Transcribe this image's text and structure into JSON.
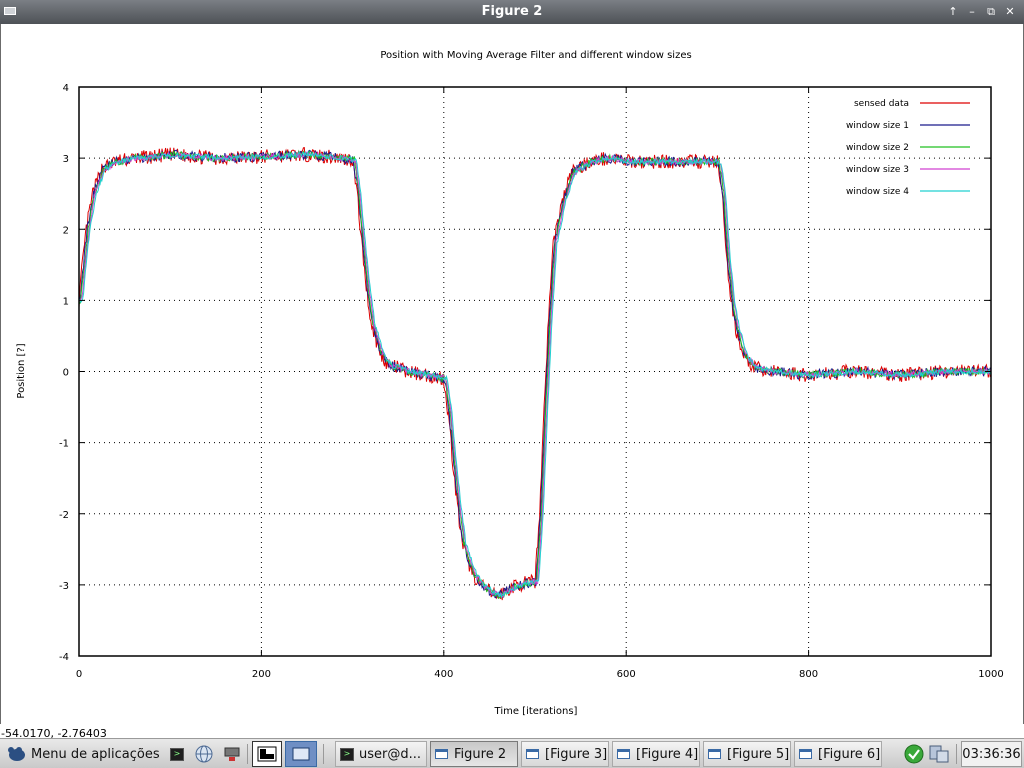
{
  "window": {
    "title": "Figure 2",
    "buttons": [
      "↑",
      "–",
      "⧉",
      "✕"
    ]
  },
  "coords_readout": "-54.0170, -2.76403",
  "chart_data": {
    "type": "line",
    "title": "Position with Moving Average Filter and different window sizes",
    "xlabel": "Time [iterations]",
    "ylabel": "Position [?]",
    "xlim": [
      0,
      1000
    ],
    "ylim": [
      -4,
      4
    ],
    "xticks": [
      0,
      200,
      400,
      600,
      800,
      1000
    ],
    "yticks": [
      -4,
      -3,
      -2,
      -1,
      0,
      1,
      2,
      3,
      4
    ],
    "grid": true,
    "legend_position": "top-right",
    "trajectory_keypoints": {
      "x": [
        0,
        3,
        8,
        15,
        25,
        40,
        60,
        80,
        100,
        150,
        200,
        250,
        300,
        305,
        310,
        315,
        320,
        330,
        340,
        350,
        360,
        380,
        400,
        405,
        410,
        415,
        420,
        430,
        440,
        450,
        460,
        480,
        500,
        505,
        510,
        515,
        520,
        530,
        540,
        560,
        580,
        600,
        650,
        700,
        705,
        710,
        715,
        720,
        730,
        740,
        760,
        800,
        850,
        900,
        950,
        1000
      ],
      "y": [
        1.0,
        1.4,
        2.0,
        2.5,
        2.85,
        2.95,
        3.0,
        3.02,
        3.05,
        3.0,
        3.02,
        3.05,
        2.98,
        2.5,
        1.8,
        1.2,
        0.7,
        0.25,
        0.08,
        0.05,
        0.0,
        -0.05,
        -0.1,
        -0.6,
        -1.3,
        -1.9,
        -2.4,
        -2.8,
        -3.0,
        -3.1,
        -3.15,
        -3.0,
        -2.95,
        -2.0,
        -0.5,
        0.8,
        1.8,
        2.4,
        2.8,
        2.95,
        3.0,
        2.95,
        2.95,
        2.95,
        2.5,
        1.6,
        1.0,
        0.6,
        0.2,
        0.05,
        0.0,
        -0.05,
        0.0,
        -0.05,
        0.0,
        0.0
      ]
    },
    "series": [
      {
        "name": "sensed data",
        "color": "#dd0000",
        "noise_amplitude": 0.1,
        "lag": 0
      },
      {
        "name": "window size 1",
        "color": "#1a1a8c",
        "noise_amplitude": 0.07,
        "lag": 1
      },
      {
        "name": "window size 2",
        "color": "#20c020",
        "noise_amplitude": 0.05,
        "lag": 2
      },
      {
        "name": "window size 3",
        "color": "#d040d0",
        "noise_amplitude": 0.04,
        "lag": 3
      },
      {
        "name": "window size 4",
        "color": "#20d0d0",
        "noise_amplitude": 0.035,
        "lag": 4
      }
    ]
  },
  "taskbar": {
    "menu_label": "Menu de aplicações",
    "tasks": [
      {
        "label": "user@d...",
        "icon": "terminal-icon",
        "active": false
      },
      {
        "label": "Figure 2",
        "icon": "window-icon",
        "active": true
      },
      {
        "label": "[Figure 3]",
        "icon": "window-icon",
        "active": false
      },
      {
        "label": "[Figure 4]",
        "icon": "window-icon",
        "active": false
      },
      {
        "label": "[Figure 5]",
        "icon": "window-icon",
        "active": false
      },
      {
        "label": "[Figure 6]",
        "icon": "window-icon",
        "active": false
      }
    ],
    "clock": "03:36:36"
  }
}
